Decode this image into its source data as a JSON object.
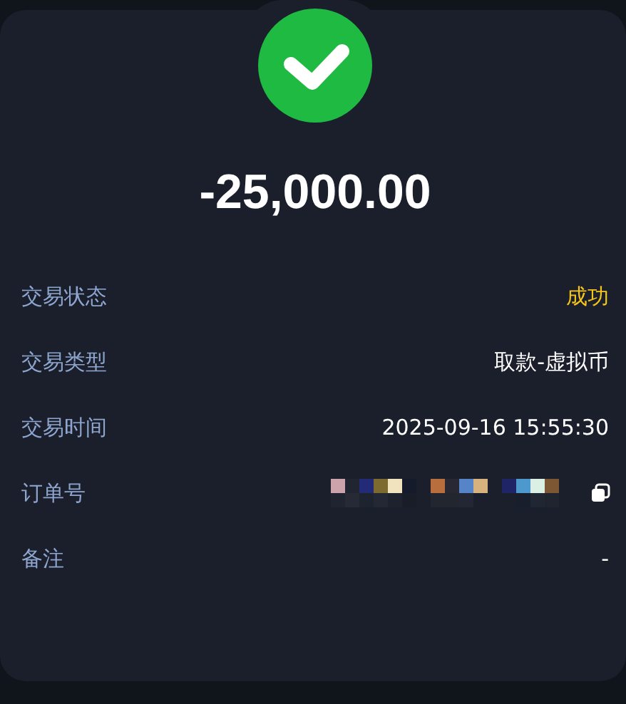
{
  "result": {
    "success": true
  },
  "amount": "-25,000.00",
  "details": [
    {
      "label": "交易状态",
      "kind": "status",
      "value": "成功"
    },
    {
      "label": "交易类型",
      "kind": "text",
      "value": "取款-虚拟币"
    },
    {
      "label": "交易时间",
      "kind": "text",
      "value": "2025-09-16 15:55:30"
    },
    {
      "label": "订单号",
      "kind": "masked",
      "copyable": true
    },
    {
      "label": "备注",
      "kind": "text",
      "value": "-"
    }
  ]
}
